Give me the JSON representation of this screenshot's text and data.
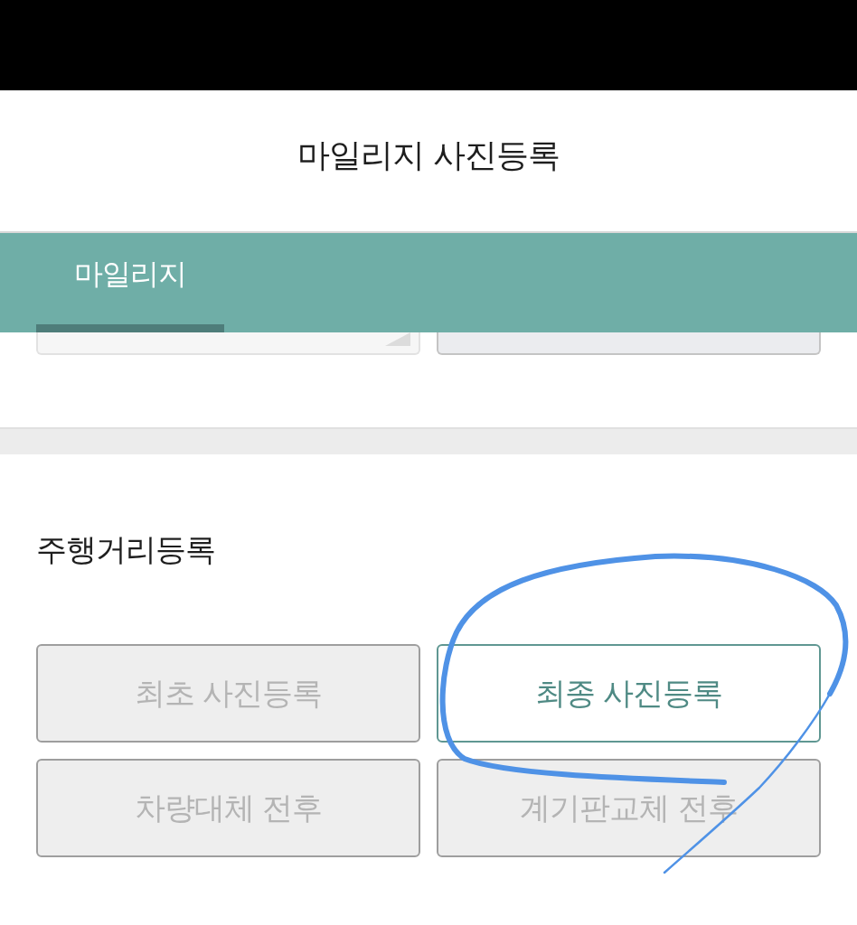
{
  "header": {
    "title": "마일리지 사진등록"
  },
  "tabs": [
    {
      "label": "마일리지",
      "selected": true
    }
  ],
  "fields": [
    {
      "kind": "select",
      "disabled": false
    },
    {
      "kind": "text",
      "disabled": true
    }
  ],
  "section": {
    "title": "주행거리등록",
    "buttons": [
      {
        "label": "최초 사진등록",
        "disabled": true
      },
      {
        "label": "최종 사진등록",
        "disabled": false
      },
      {
        "label": "차량대체 전후",
        "disabled": true
      },
      {
        "label": "계기판교체 전후",
        "disabled": true
      }
    ]
  }
}
